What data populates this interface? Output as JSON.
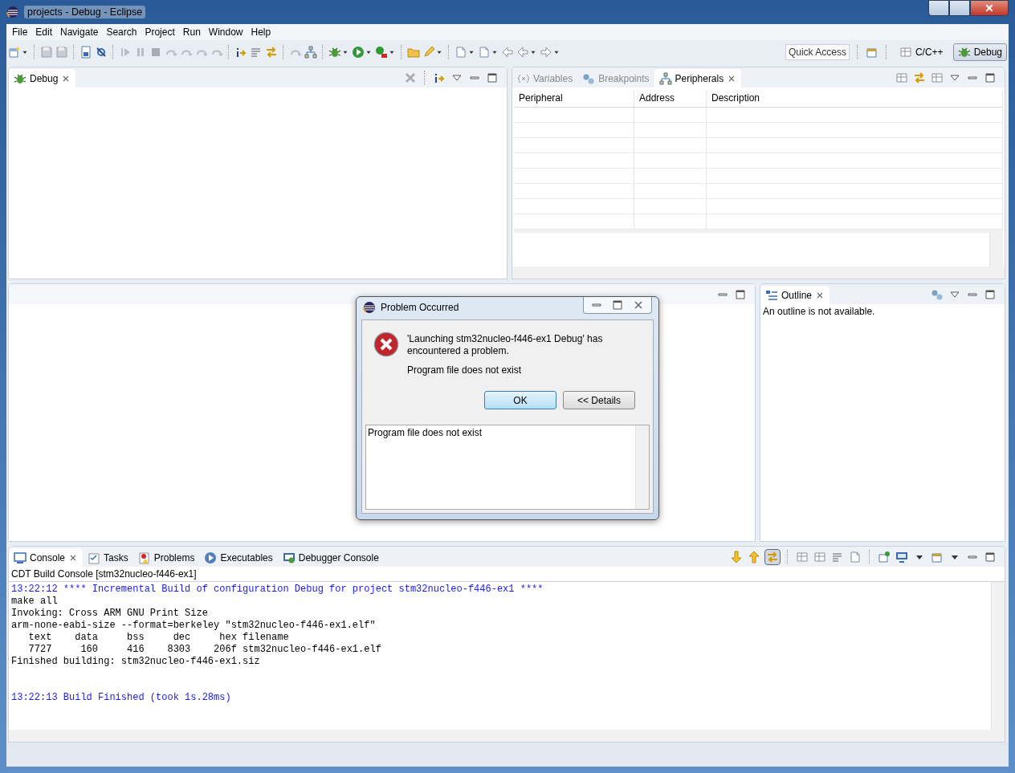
{
  "window": {
    "title": "projects - Debug - Eclipse"
  },
  "menu": [
    "File",
    "Edit",
    "Navigate",
    "Search",
    "Project",
    "Run",
    "Window",
    "Help"
  ],
  "toolbar": {
    "quick_access": {
      "placeholder": "Quick Access"
    },
    "perspectives": [
      {
        "label": "C/C++",
        "selected": false
      },
      {
        "label": "Debug",
        "selected": true
      }
    ]
  },
  "debug_view": {
    "tabs": [
      {
        "label": "Debug",
        "selected": true
      }
    ]
  },
  "right_view": {
    "tabs": [
      {
        "label": "Variables",
        "selected": false
      },
      {
        "label": "Breakpoints",
        "selected": false
      },
      {
        "label": "Peripherals",
        "selected": true
      }
    ],
    "table": {
      "columns": [
        "Peripheral",
        "Address",
        "Description"
      ]
    }
  },
  "outline_view": {
    "tabs": [
      {
        "label": "Outline",
        "selected": true
      }
    ],
    "message": "An outline is not available."
  },
  "console_view": {
    "tabs": [
      {
        "label": "Console",
        "selected": true
      },
      {
        "label": "Tasks",
        "selected": false
      },
      {
        "label": "Problems",
        "selected": false
      },
      {
        "label": "Executables",
        "selected": false
      },
      {
        "label": "Debugger Console",
        "selected": false
      }
    ],
    "title": "CDT Build Console [stm32nucleo-f446-ex1]",
    "lines": [
      {
        "kind": "info",
        "text": "13:22:12 **** Incremental Build of configuration Debug for project stm32nucleo-f446-ex1 ****"
      },
      {
        "kind": "output",
        "text": "make all"
      },
      {
        "kind": "output",
        "text": "Invoking: Cross ARM GNU Print Size"
      },
      {
        "kind": "output",
        "text": "arm-none-eabi-size --format=berkeley \"stm32nucleo-f446-ex1.elf\""
      },
      {
        "kind": "output",
        "text": "   text\t   data\t    bss\t    dec\t    hex\tfilename"
      },
      {
        "kind": "output",
        "text": "   7727\t    160\t    416\t   8303\t   206f\tstm32nucleo-f446-ex1.elf"
      },
      {
        "kind": "output",
        "text": "Finished building: stm32nucleo-f446-ex1.siz"
      },
      {
        "kind": "summary",
        "text": "13:22:13 Build Finished (took 1s.28ms)"
      }
    ]
  },
  "dialog": {
    "title": "Problem Occurred",
    "message": "'Launching stm32nucleo-f446-ex1 Debug' has encountered a problem.",
    "reason": "Program file does not exist",
    "buttons": [
      {
        "label": "OK",
        "default": true
      },
      {
        "label": "<< Details",
        "default": false
      }
    ],
    "details": "Program file does not exist"
  }
}
